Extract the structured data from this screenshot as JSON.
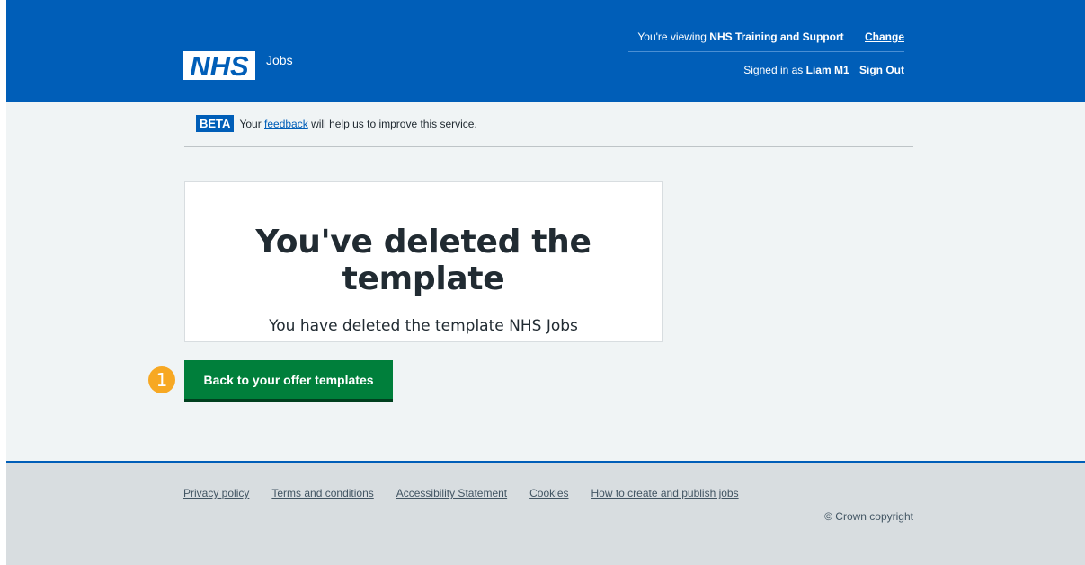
{
  "header": {
    "logo_text": "NHS",
    "service_name": "Jobs",
    "viewing_prefix": "You're viewing",
    "organisation": "NHS Training and Support",
    "change_link": "Change",
    "signed_in_prefix": "Signed in as",
    "user_name": "Liam M1",
    "sign_out": "Sign Out",
    "brand_color": "#005eb8"
  },
  "beta_banner": {
    "tag": "BETA",
    "text_before": "Your",
    "link": "feedback",
    "text_after": "will help us to improve this service."
  },
  "confirmation": {
    "title": "You've deleted the template",
    "body": "You have deleted the template NHS Jobs"
  },
  "step_marker": "1",
  "primary_button": {
    "label": "Back to your offer templates",
    "color": "#007f3b"
  },
  "footer": {
    "links": [
      "Privacy policy",
      "Terms and conditions",
      "Accessibility Statement",
      "Cookies",
      "How to create and publish jobs"
    ],
    "copyright": "© Crown copyright"
  }
}
